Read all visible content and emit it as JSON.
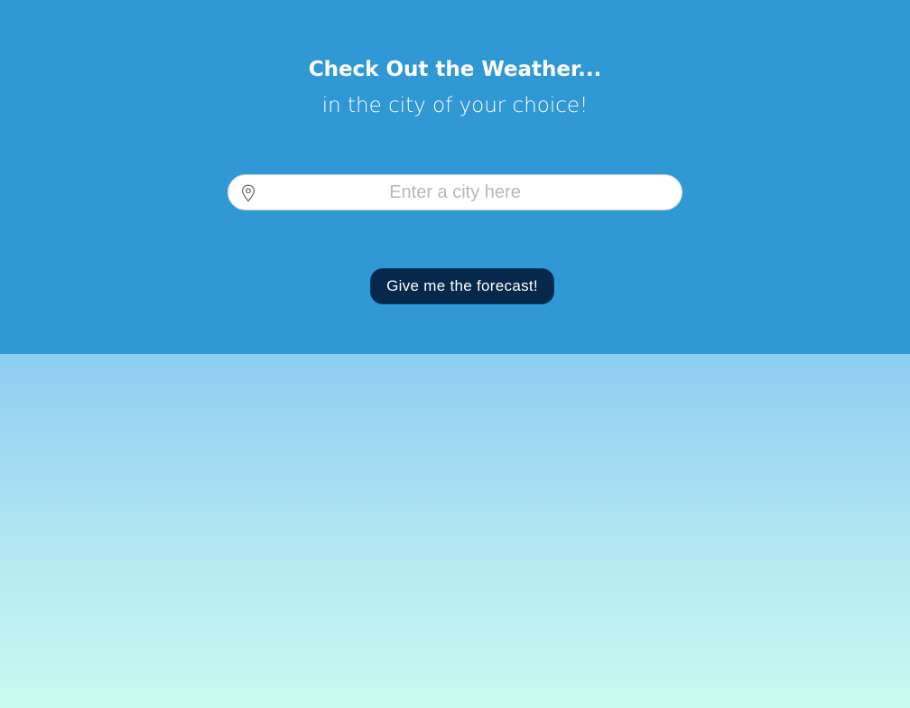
{
  "header": {
    "title": "Check Out the Weather...",
    "subtitle": "in the city of your choice!"
  },
  "search": {
    "icon": "location-pin-icon",
    "placeholder": "Enter a city here",
    "value": ""
  },
  "action": {
    "button_label": "Give me the forecast!"
  },
  "colors": {
    "header_bg": "#3198d6",
    "button_bg": "#06284a",
    "gradient_top": "#8dcdf3",
    "gradient_bottom": "#c9fbf1"
  }
}
